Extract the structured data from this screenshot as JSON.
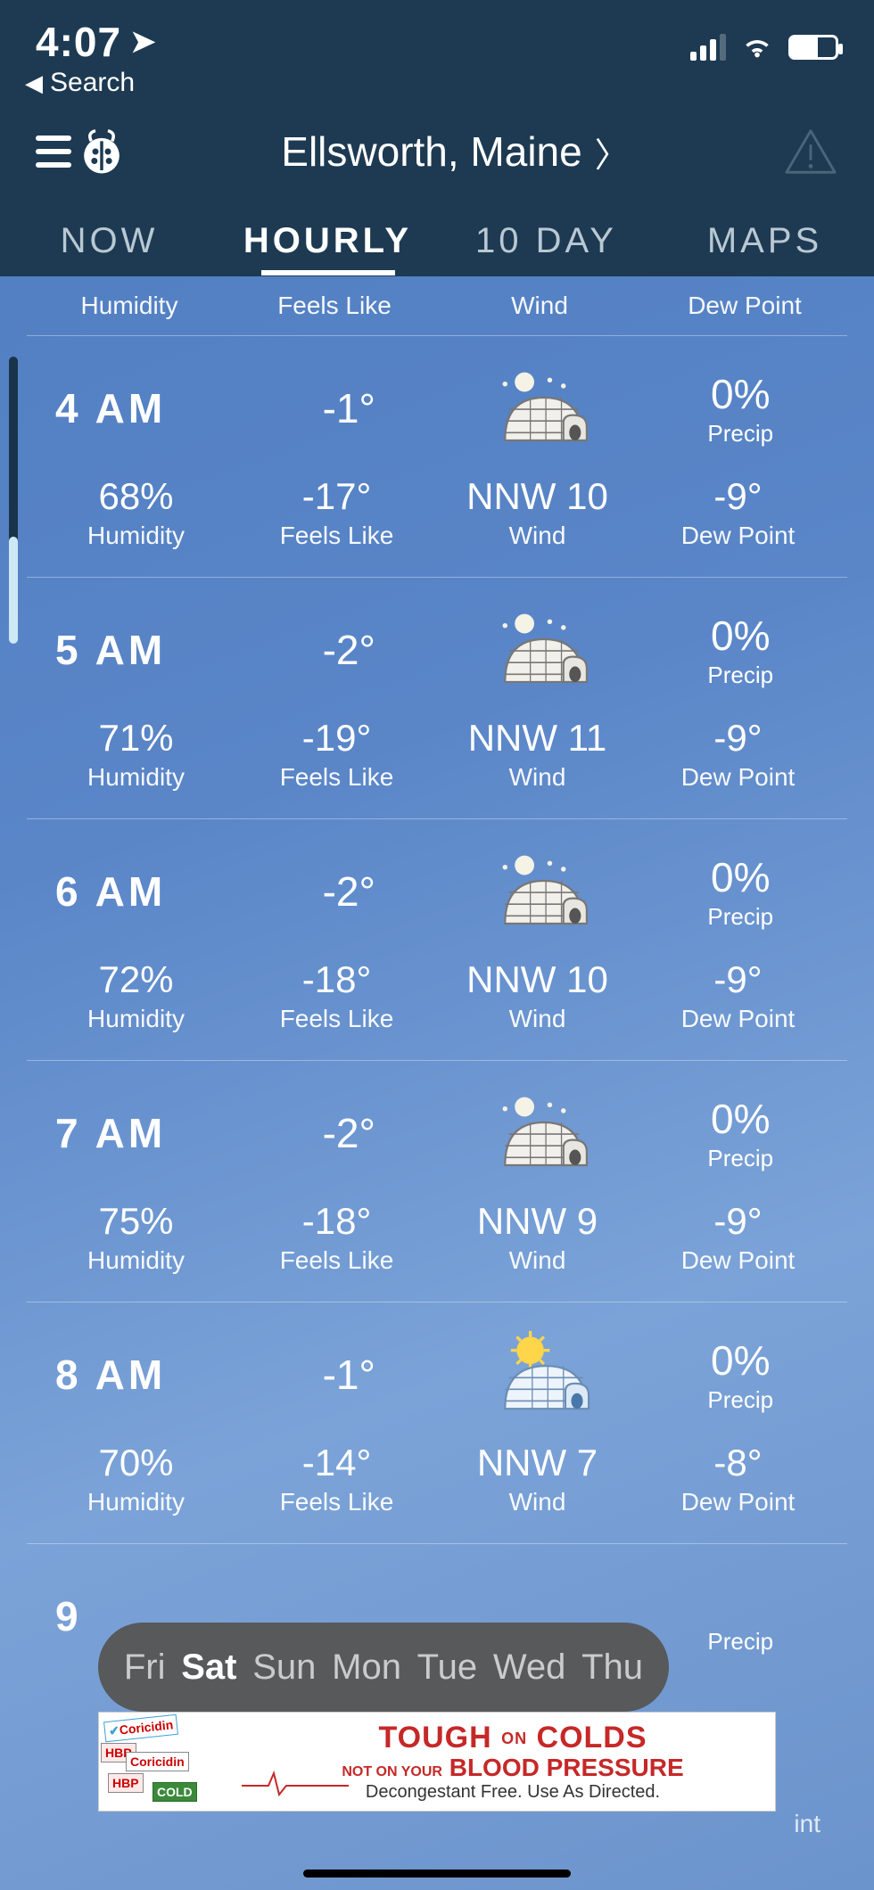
{
  "status": {
    "time": "4:07",
    "back_label": "Search"
  },
  "location": "Ellsworth, Maine",
  "tabs": [
    "NOW",
    "HOURLY",
    "10 DAY",
    "MAPS"
  ],
  "active_tab_index": 1,
  "sub_labels": [
    "Humidity",
    "Feels Like",
    "Wind",
    "Dew Point"
  ],
  "detail_labels": {
    "humidity": "Humidity",
    "feels": "Feels Like",
    "wind": "Wind",
    "dew": "Dew Point",
    "precip": "Precip"
  },
  "hours": [
    {
      "time": "4 AM",
      "temp": "-1°",
      "icon": "night",
      "precip": "0%",
      "humidity": "68%",
      "feels": "-17°",
      "wind": "NNW 10",
      "dew": "-9°"
    },
    {
      "time": "5 AM",
      "temp": "-2°",
      "icon": "night",
      "precip": "0%",
      "humidity": "71%",
      "feels": "-19°",
      "wind": "NNW 11",
      "dew": "-9°"
    },
    {
      "time": "6 AM",
      "temp": "-2°",
      "icon": "night",
      "precip": "0%",
      "humidity": "72%",
      "feels": "-18°",
      "wind": "NNW 10",
      "dew": "-9°"
    },
    {
      "time": "7 AM",
      "temp": "-2°",
      "icon": "night",
      "precip": "0%",
      "humidity": "75%",
      "feels": "-18°",
      "wind": "NNW 9",
      "dew": "-9°"
    },
    {
      "time": "8 AM",
      "temp": "-1°",
      "icon": "day",
      "precip": "0%",
      "humidity": "70%",
      "feels": "-14°",
      "wind": "NNW 7",
      "dew": "-8°"
    }
  ],
  "partial_hour": {
    "time": "9",
    "precip_label": "Precip"
  },
  "days": [
    "Fri",
    "Sat",
    "Sun",
    "Mon",
    "Tue",
    "Wed",
    "Thu"
  ],
  "selected_day_index": 1,
  "ad": {
    "brand": "Coricidin",
    "hbp": "HBP",
    "line1a": "TOUGH",
    "line1on": "ON",
    "line1b": "COLDS",
    "line2not": "NOT ON YOUR",
    "line2b": "BLOOD PRESSURE",
    "line3": "Decongestant Free. Use As Directed."
  },
  "faint_bottom_right": "int"
}
